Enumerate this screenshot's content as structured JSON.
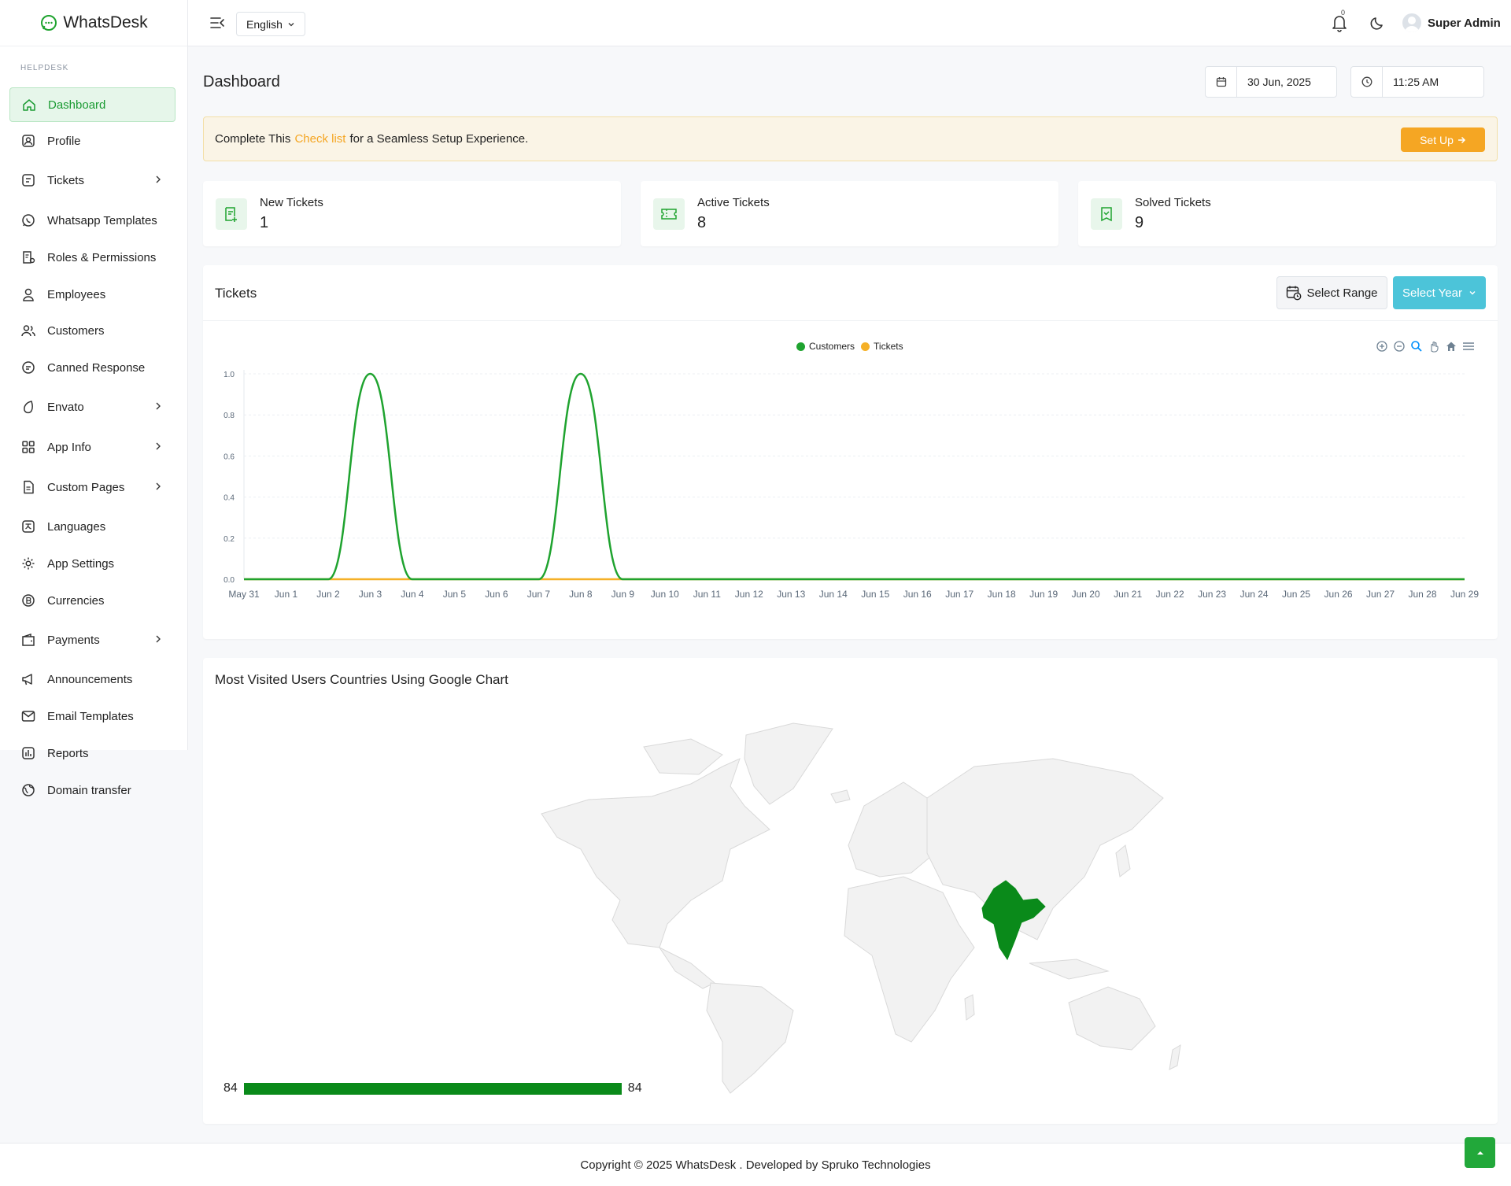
{
  "brand": {
    "name": "WhatsDesk"
  },
  "header": {
    "language": "English",
    "notification_count": "0",
    "user_name": "Super Admin"
  },
  "sidebar": {
    "section": "HELPDESK",
    "items": [
      {
        "label": "Dashboard",
        "icon": "home-icon",
        "active": true
      },
      {
        "label": "Profile",
        "icon": "profile-icon"
      },
      {
        "label": "Tickets",
        "icon": "tickets-icon",
        "has_children": true
      },
      {
        "label": "Whatsapp Templates",
        "icon": "whatsapp-icon"
      },
      {
        "label": "Roles & Permissions",
        "icon": "roles-icon"
      },
      {
        "label": "Employees",
        "icon": "employee-icon"
      },
      {
        "label": "Customers",
        "icon": "customers-icon"
      },
      {
        "label": "Canned Response",
        "icon": "chat-icon"
      },
      {
        "label": "Envato",
        "icon": "envato-icon",
        "has_children": true
      },
      {
        "label": "App Info",
        "icon": "grid-icon",
        "has_children": true
      },
      {
        "label": "Custom Pages",
        "icon": "page-icon",
        "has_children": true
      },
      {
        "label": "Languages",
        "icon": "language-icon"
      },
      {
        "label": "App Settings",
        "icon": "gear-icon"
      },
      {
        "label": "Currencies",
        "icon": "currency-icon"
      },
      {
        "label": "Payments",
        "icon": "wallet-icon",
        "has_children": true
      },
      {
        "label": "Announcements",
        "icon": "megaphone-icon"
      },
      {
        "label": "Email Templates",
        "icon": "mail-icon"
      },
      {
        "label": "Reports",
        "icon": "report-icon"
      },
      {
        "label": "Domain transfer",
        "icon": "globe-icon"
      }
    ]
  },
  "page": {
    "title": "Dashboard",
    "date": "30 Jun, 2025",
    "time": "11:25 AM"
  },
  "alert": {
    "prefix": "Complete This",
    "link": "Check list",
    "suffix": "for a Seamless Setup Experience.",
    "button": "Set Up"
  },
  "stats": [
    {
      "label": "New Tickets",
      "value": "1"
    },
    {
      "label": "Active Tickets",
      "value": "8"
    },
    {
      "label": "Solved Tickets",
      "value": "9"
    }
  ],
  "tickets_card": {
    "title": "Tickets",
    "range_button": "Select Range",
    "year_button": "Select Year"
  },
  "chart_data": {
    "type": "area",
    "x": [
      "May 31",
      "Jun 1",
      "Jun 2",
      "Jun 3",
      "Jun 4",
      "Jun 5",
      "Jun 6",
      "Jun 7",
      "Jun 8",
      "Jun 9",
      "Jun 10",
      "Jun 11",
      "Jun 12",
      "Jun 13",
      "Jun 14",
      "Jun 15",
      "Jun 16",
      "Jun 17",
      "Jun 18",
      "Jun 19",
      "Jun 20",
      "Jun 21",
      "Jun 22",
      "Jun 23",
      "Jun 24",
      "Jun 25",
      "Jun 26",
      "Jun 27",
      "Jun 28",
      "Jun 29"
    ],
    "series": [
      {
        "name": "Customers",
        "color": "#1fa32f",
        "values": [
          0,
          0,
          0,
          1,
          0,
          0,
          0,
          0,
          1,
          0,
          0,
          0,
          0,
          0,
          0,
          0,
          0,
          0,
          0,
          0,
          0,
          0,
          0,
          0,
          0,
          0,
          0,
          0,
          0,
          0
        ]
      },
      {
        "name": "Tickets",
        "color": "#f5b027",
        "values": [
          0,
          0,
          0,
          0,
          0,
          0,
          0,
          0,
          0,
          0,
          0,
          0,
          0,
          0,
          0,
          0,
          0,
          0,
          0,
          0,
          0,
          0,
          0,
          0,
          0,
          0,
          0,
          0,
          0,
          0
        ]
      }
    ],
    "ylim": [
      0,
      1
    ],
    "yticks": [
      "0.0",
      "0.2",
      "0.4",
      "0.6",
      "0.8",
      "1.0"
    ],
    "legend": "top-center",
    "grid": true
  },
  "map_card": {
    "title": "Most Visited Users Countries Using Google Chart",
    "highlighted_country": "India",
    "highlight_color": "#0a8a1a",
    "scale_min": "84",
    "scale_max": "84"
  },
  "footer": {
    "text": "Copyright © 2025 WhatsDesk . Developed by Spruko Technologies"
  }
}
